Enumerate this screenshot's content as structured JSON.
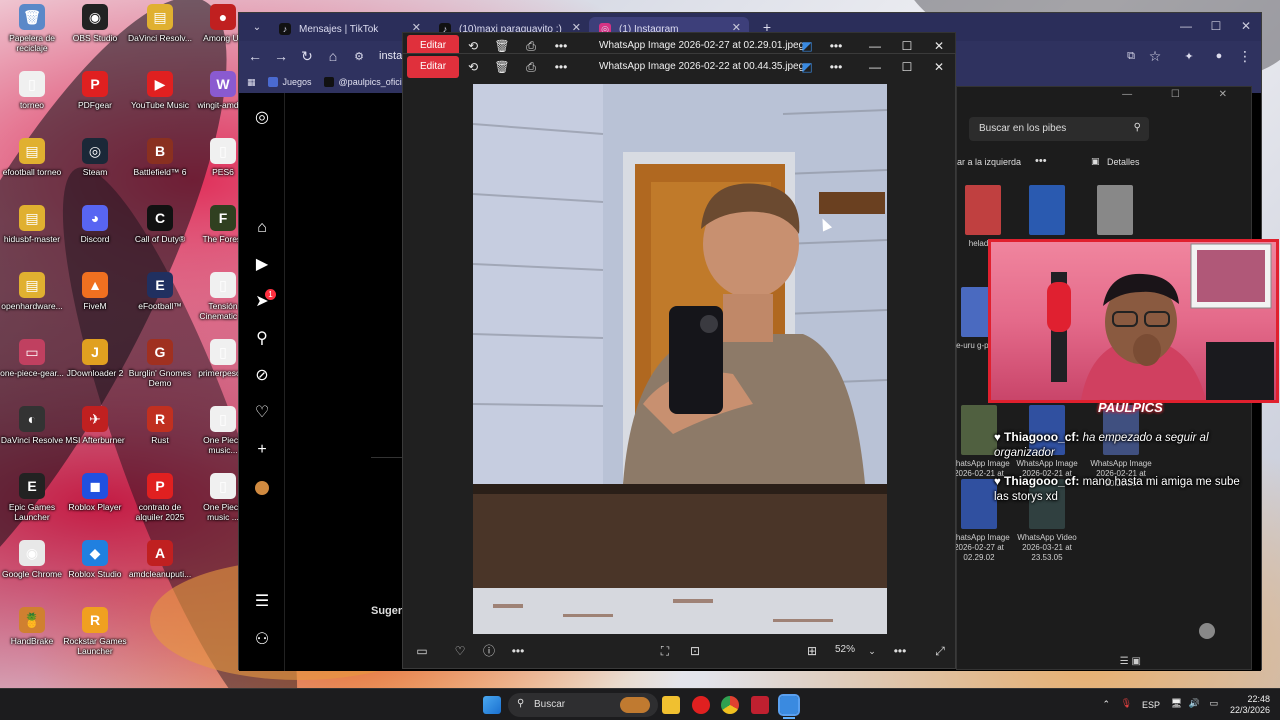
{
  "desktop": {
    "icons": [
      {
        "label": "Papelera de reciclaje",
        "color": "#5a88c8",
        "glyph": "🗑"
      },
      {
        "label": "OBS Studio",
        "color": "#222",
        "glyph": "◉"
      },
      {
        "label": "DaVinci Resolv...",
        "color": "#e0b030",
        "glyph": "▤"
      },
      {
        "label": "Among Us",
        "color": "#c02020",
        "glyph": "●"
      },
      {
        "label": "torneo",
        "color": "#f0f0f0",
        "glyph": "▯"
      },
      {
        "label": "PDFgear",
        "color": "#e02020",
        "glyph": "P"
      },
      {
        "label": "YouTube Music",
        "color": "#e02020",
        "glyph": "▶"
      },
      {
        "label": "wingit-amd-...",
        "color": "#8a5ad0",
        "glyph": "W"
      },
      {
        "label": "efootball torneo",
        "color": "#e0b030",
        "glyph": "▤"
      },
      {
        "label": "Steam",
        "color": "#1b2838",
        "glyph": "◎"
      },
      {
        "label": "Battlefield™ 6",
        "color": "#8a3020",
        "glyph": "B"
      },
      {
        "label": "PES6",
        "color": "#f0f0f0",
        "glyph": "▯"
      },
      {
        "label": "hidusbf-master",
        "color": "#e0b030",
        "glyph": "▤"
      },
      {
        "label": "Discord",
        "color": "#5865f2",
        "glyph": "◕"
      },
      {
        "label": "Call of Duty®",
        "color": "#111",
        "glyph": "C"
      },
      {
        "label": "The Forest",
        "color": "#304020",
        "glyph": "F"
      },
      {
        "label": "openhardware...",
        "color": "#e0b030",
        "glyph": "▤"
      },
      {
        "label": "FiveM",
        "color": "#f07020",
        "glyph": "▲"
      },
      {
        "label": "eFootball™",
        "color": "#203060",
        "glyph": "E"
      },
      {
        "label": "Tensión Cinematic ...",
        "color": "#f0f0f0",
        "glyph": "▯"
      },
      {
        "label": "one-piece-gear...",
        "color": "#c04060",
        "glyph": "▭"
      },
      {
        "label": "JDownloader 2",
        "color": "#e0a020",
        "glyph": "J"
      },
      {
        "label": "Burglin' Gnomes Demo",
        "color": "#a03020",
        "glyph": "G"
      },
      {
        "label": "primerpeso...",
        "color": "#f0f0f0",
        "glyph": "▯"
      },
      {
        "label": "DaVinci Resolve",
        "color": "#333",
        "glyph": "◐"
      },
      {
        "label": "MSI Afterburner",
        "color": "#c02020",
        "glyph": "✈"
      },
      {
        "label": "Rust",
        "color": "#c03020",
        "glyph": "R"
      },
      {
        "label": "One Piece music...",
        "color": "#f0f0f0",
        "glyph": "▯"
      },
      {
        "label": "Epic Games Launcher",
        "color": "#222",
        "glyph": "E"
      },
      {
        "label": "Roblox Player",
        "color": "#2050e0",
        "glyph": "◼"
      },
      {
        "label": "contrato de alquiler 2025",
        "color": "#e02020",
        "glyph": "P"
      },
      {
        "label": "One Piece music ...",
        "color": "#f0f0f0",
        "glyph": "▯"
      },
      {
        "label": "Google Chrome",
        "color": "#e8e8e8",
        "glyph": "◉"
      },
      {
        "label": "Roblox Studio",
        "color": "#2080e0",
        "glyph": "◆"
      },
      {
        "label": "amdcleanuputi...",
        "color": "#c02020",
        "glyph": "A"
      },
      {
        "label": "",
        "color": "transparent",
        "glyph": ""
      },
      {
        "label": "HandBrake",
        "color": "#d08030",
        "glyph": "🍍"
      },
      {
        "label": "Rockstar Games Launcher",
        "color": "#f0a020",
        "glyph": "R"
      }
    ]
  },
  "browser": {
    "tabs": [
      {
        "label": "Mensajes | TikTok",
        "icon": "tiktok-icon",
        "color": "#111"
      },
      {
        "label": "(10)maxi paraguayito :) (@maxi...",
        "icon": "tiktok-icon",
        "color": "#111"
      },
      {
        "label": "(1) Instagram",
        "icon": "instagram-icon",
        "color": "#d63384"
      }
    ],
    "new_tab": "+",
    "url": "instagram",
    "bookmarks": [
      {
        "label": "Juegos",
        "color": "#4a6ad0"
      },
      {
        "label": "@paulpics_oficial",
        "color": "#111"
      }
    ]
  },
  "instagram": {
    "notification_count": "1",
    "suggested_label": "Sugere"
  },
  "explorer": {
    "search_placeholder": "Buscar en los pibes",
    "move_left": "ar a la izquierda",
    "details": "Detalles",
    "items": [
      {
        "label": "helado2",
        "color": "#c04040"
      },
      {
        "label": "",
        "color": "#2a5ab0"
      },
      {
        "label": "",
        "color": "#888"
      },
      {
        "label": "gtree-uru g-png-ir _8",
        "color": "#4a6ac0"
      },
      {
        "label": "WhatsApp Image 2026-02-21 at 20.05.49",
        "color": "#506040"
      },
      {
        "label": "WhatsApp Image 2026-02-21 at 20.08.58",
        "color": "#3050a0"
      },
      {
        "label": "WhatsApp Image 2026-02-21 at 20.20.29",
        "color": "#405080"
      },
      {
        "label": "WhatsApp Image 2026-02-27 at 02.29.02",
        "color": "#3050a0"
      },
      {
        "label": "WhatsApp Video 2026-03-21 at 23.53.05",
        "color": "#304040"
      }
    ]
  },
  "viewer_back": {
    "edit_label": "Editar",
    "title": "WhatsApp Image 2026-02-27 at 02.29.01.jpeg"
  },
  "viewer": {
    "edit_label": "Editar",
    "title": "WhatsApp Image 2026-02-22 at 00.44.35.jpeg",
    "zoom": "52%"
  },
  "stream": {
    "channel": "PAULPICS",
    "chat": [
      {
        "user": "Thiagooo_cf:",
        "message": "ha empezado a seguir al organizador",
        "italic": true
      },
      {
        "user": "Thiagooo_cf:",
        "message": "mano hasta mi amiga me sube las storys xd",
        "italic": false
      }
    ]
  },
  "taskbar": {
    "search": "Buscar",
    "language": "ESP",
    "time": "22:48",
    "date": "22/3/2026"
  }
}
